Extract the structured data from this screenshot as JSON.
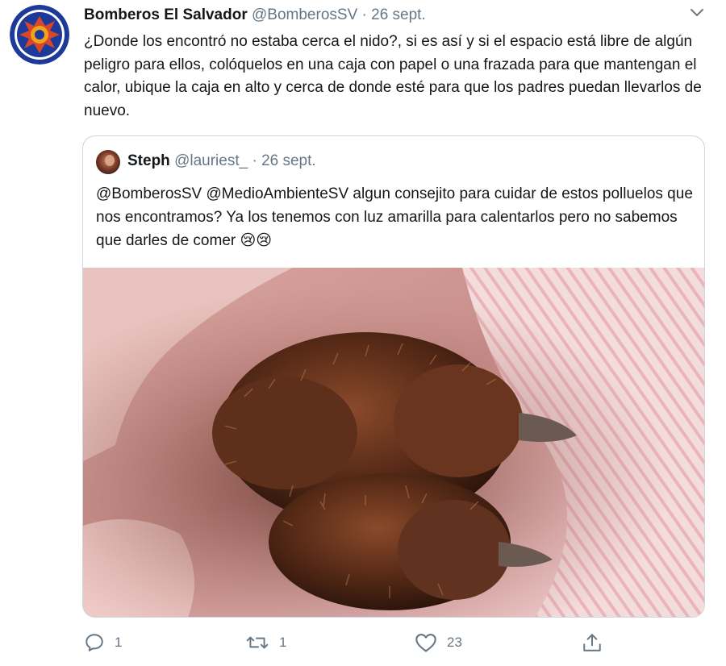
{
  "tweet": {
    "author_name": "Bomberos El Salvador",
    "handle": "@BomberosSV",
    "separator": "·",
    "date": "26 sept.",
    "text": "¿Donde los encontró no estaba cerca el nido?, si es así y si el espacio está libre de algún peligro para ellos, colóquelos en una caja con papel o una frazada para que mantengan el calor, ubique la caja en alto y cerca de donde esté para que los padres puedan llevarlos de nuevo."
  },
  "quoted": {
    "author_name": "Steph",
    "handle": "@lauriest_",
    "separator": "·",
    "date": "26 sept.",
    "text": "@BomberosSV @MedioAmbienteSV  algun consejito para cuidar de estos polluelos que nos encontramos? Ya los tenemos con luz amarilla para calentarlos pero no sabemos que darles de comer",
    "emojis": "😢😢"
  },
  "actions": {
    "reply_count": "1",
    "retweet_count": "1",
    "like_count": "23"
  },
  "icons": [
    "reply-icon",
    "retweet-icon",
    "like-icon",
    "share-icon",
    "chevron-down-icon"
  ],
  "colors": {
    "muted": "#657786",
    "border": "#ccd6dd",
    "text": "#14171a"
  }
}
